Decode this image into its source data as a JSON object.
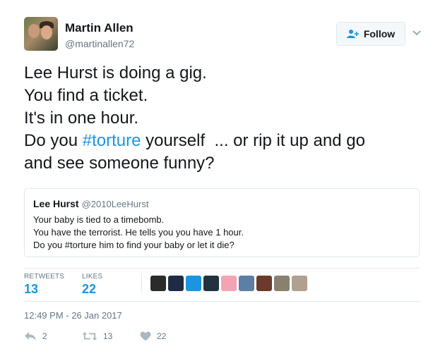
{
  "author": {
    "name": "Martin Allen",
    "handle": "@martinallen72"
  },
  "follow_button": {
    "label": "Follow"
  },
  "tweet": {
    "line1": "Lee Hurst is doing a gig.",
    "line2": "You find a ticket.",
    "line3": "It's in one hour.",
    "line4_before": "Do you ",
    "hashtag": "#torture",
    "line4_after": " yourself  ... or rip it up and go",
    "line5": "and see someone funny?"
  },
  "quoted_tweet": {
    "name": "Lee Hurst",
    "handle": "@2010LeeHurst",
    "lines": [
      "Your baby is tied to a timebomb.",
      "You have the terrorist. He tells you you have 1 hour.",
      "Do you #torture him to find your baby or let it die?"
    ]
  },
  "stats": {
    "retweets_label": "RETWEETS",
    "retweets_count": "13",
    "likes_label": "LIKES",
    "likes_count": "22"
  },
  "likers": [
    {
      "color": "#2b2b2b",
      "icon": "avatar-dark"
    },
    {
      "color": "#1f2a44",
      "icon": "avatar-blue-dark"
    },
    {
      "color": "#1b95e0",
      "icon": "avatar-blue-line"
    },
    {
      "color": "#23323f",
      "icon": "avatar-dark-teal"
    },
    {
      "color": "#f4a3b5",
      "icon": "avatar-pink-face"
    },
    {
      "color": "#5d7fa3",
      "icon": "avatar-blue-grey"
    },
    {
      "color": "#6b3a2a",
      "icon": "avatar-brown"
    },
    {
      "color": "#8a8070",
      "icon": "avatar-khaki"
    },
    {
      "color": "#b0a090",
      "icon": "avatar-bald-man"
    }
  ],
  "timestamp": "12:49 PM - 26 Jan 2017",
  "actions": {
    "reply_count": "2",
    "retweet_count": "13",
    "like_count": "22"
  }
}
